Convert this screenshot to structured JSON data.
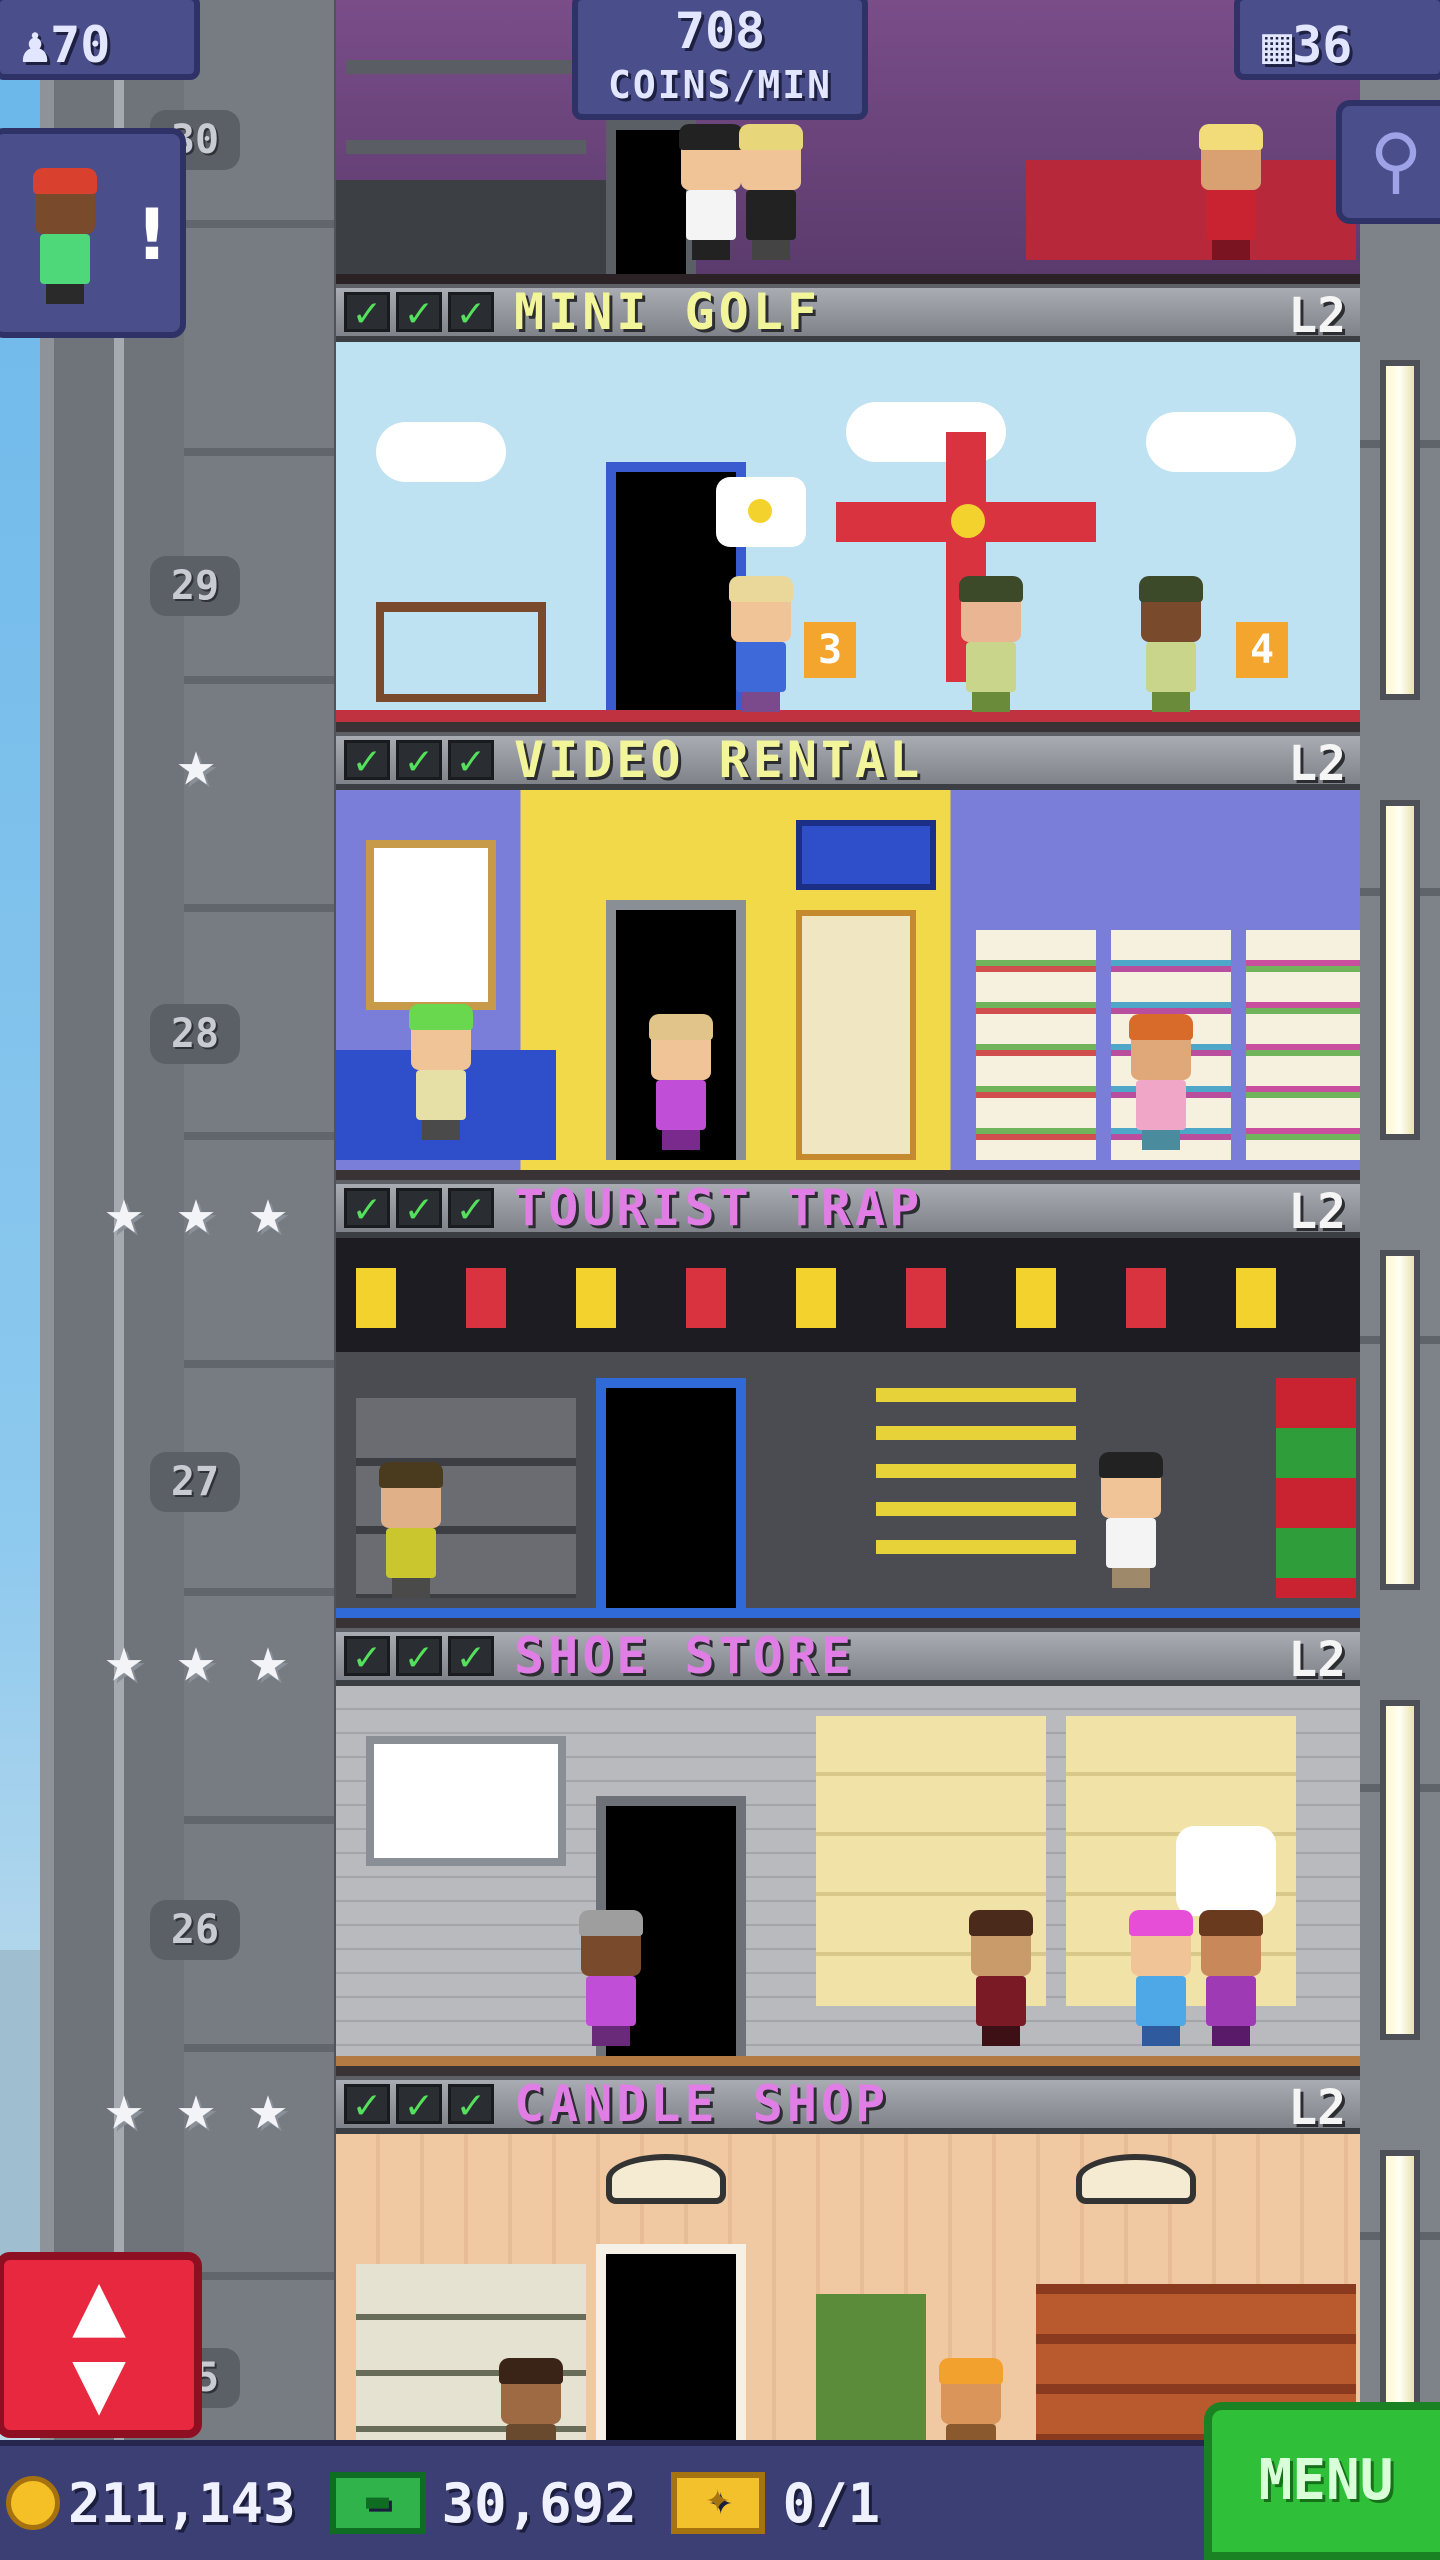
{
  "hud": {
    "population": "70",
    "coins_per_min_value": "708",
    "coins_per_min_label": "COINS/MIN",
    "floors_count": "36"
  },
  "floors": [
    {
      "name": "MINI GOLF",
      "level": "L2",
      "number": "29",
      "name_color": "#f2f59a"
    },
    {
      "name": "VIDEO RENTAL",
      "level": "L2",
      "number": "28",
      "name_color": "#f2f59a"
    },
    {
      "name": "TOURIST TRAP",
      "level": "L2",
      "number": "27",
      "name_color": "#e07ee6"
    },
    {
      "name": "SHOE STORE",
      "level": "L2",
      "number": "26",
      "name_color": "#e07ee6"
    },
    {
      "name": "CANDLE SHOP",
      "level": "L2",
      "number": "25",
      "name_color": "#e07ee6"
    }
  ],
  "top_floor_number": "30",
  "room_details": {
    "mini_golf_signs": [
      "3",
      "4"
    ]
  },
  "bottom_bar": {
    "coins": "211,143",
    "bux": "30,692",
    "tickets": "0/1",
    "menu_label": "MENU"
  },
  "icons": {
    "population": "person-icon",
    "floors": "building-icon",
    "zoom": "magnifier-icon",
    "elevator": "up-down-arrows-icon",
    "coin": "coin-icon",
    "bux": "bux-bill-icon",
    "ticket": "golden-ticket-icon",
    "check": "check-icon",
    "star": "star-icon"
  },
  "colors": {
    "hud_bg": "#4a4e8a",
    "menu_green": "#2fbf38",
    "elevator_red": "#e8283f",
    "check_green": "#54e05a"
  }
}
